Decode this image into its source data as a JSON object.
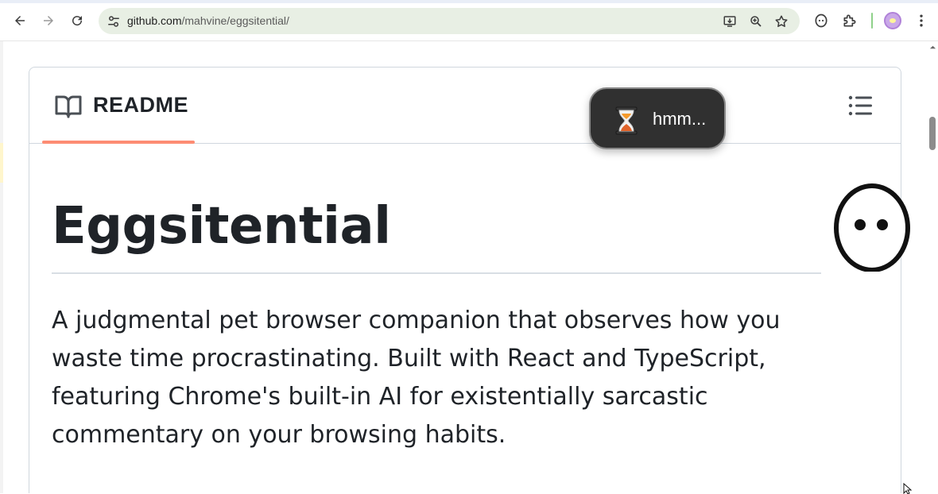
{
  "browser": {
    "back_icon": "arrow-left-icon",
    "forward_icon": "arrow-right-icon",
    "reload_icon": "reload-icon",
    "url_host": "github.com",
    "url_path": "/mahvine/eggsitential/",
    "site_info_icon": "tune-icon",
    "omnibox_icons": [
      "install-app-icon",
      "zoom-icon",
      "star-icon"
    ],
    "extension_icons": [
      "extension-face-icon",
      "puzzle-icon"
    ],
    "menu_icon": "kebab-menu-icon",
    "accent_separator": "#8fd18a"
  },
  "readme": {
    "tab_label": "README",
    "underline_color": "#fd8c73",
    "heading": "Eggsitential",
    "description": "A judgmental pet browser companion that observes how you waste time procrastinating. Built with React and TypeScript, featuring Chrome's built-in AI for existentially sarcastic commentary on your browsing habits."
  },
  "pet": {
    "bubble_icon": "hourglass-icon",
    "bubble_text": "hmm...",
    "bubble_bg": "#303030"
  }
}
